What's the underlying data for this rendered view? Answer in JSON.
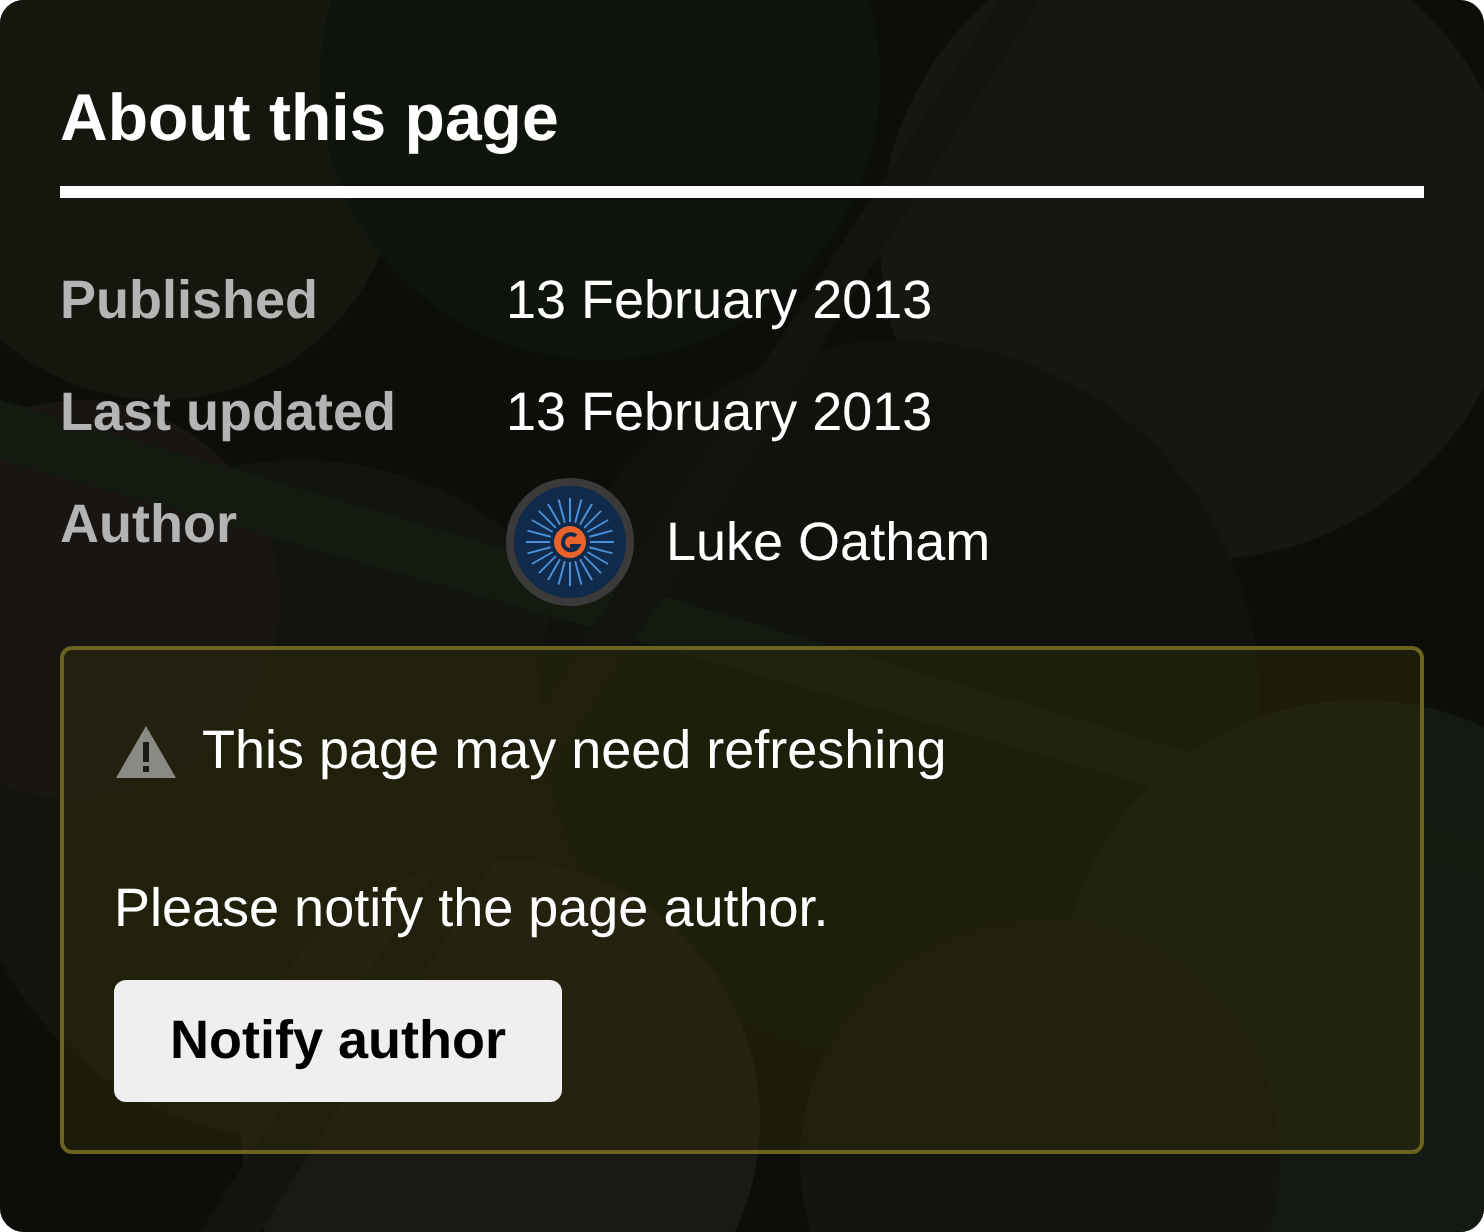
{
  "title": "About this page",
  "details": [
    {
      "label": "Published",
      "value": "13 February 2013",
      "kind": "text"
    },
    {
      "label": "Last updated",
      "value": "13 February 2013",
      "kind": "text"
    },
    {
      "label": "Author",
      "value": "Luke Oatham",
      "kind": "person"
    }
  ],
  "notice": {
    "heading": "This page may need refreshing",
    "message": "Please notify the page author.",
    "button": "Notify author"
  }
}
